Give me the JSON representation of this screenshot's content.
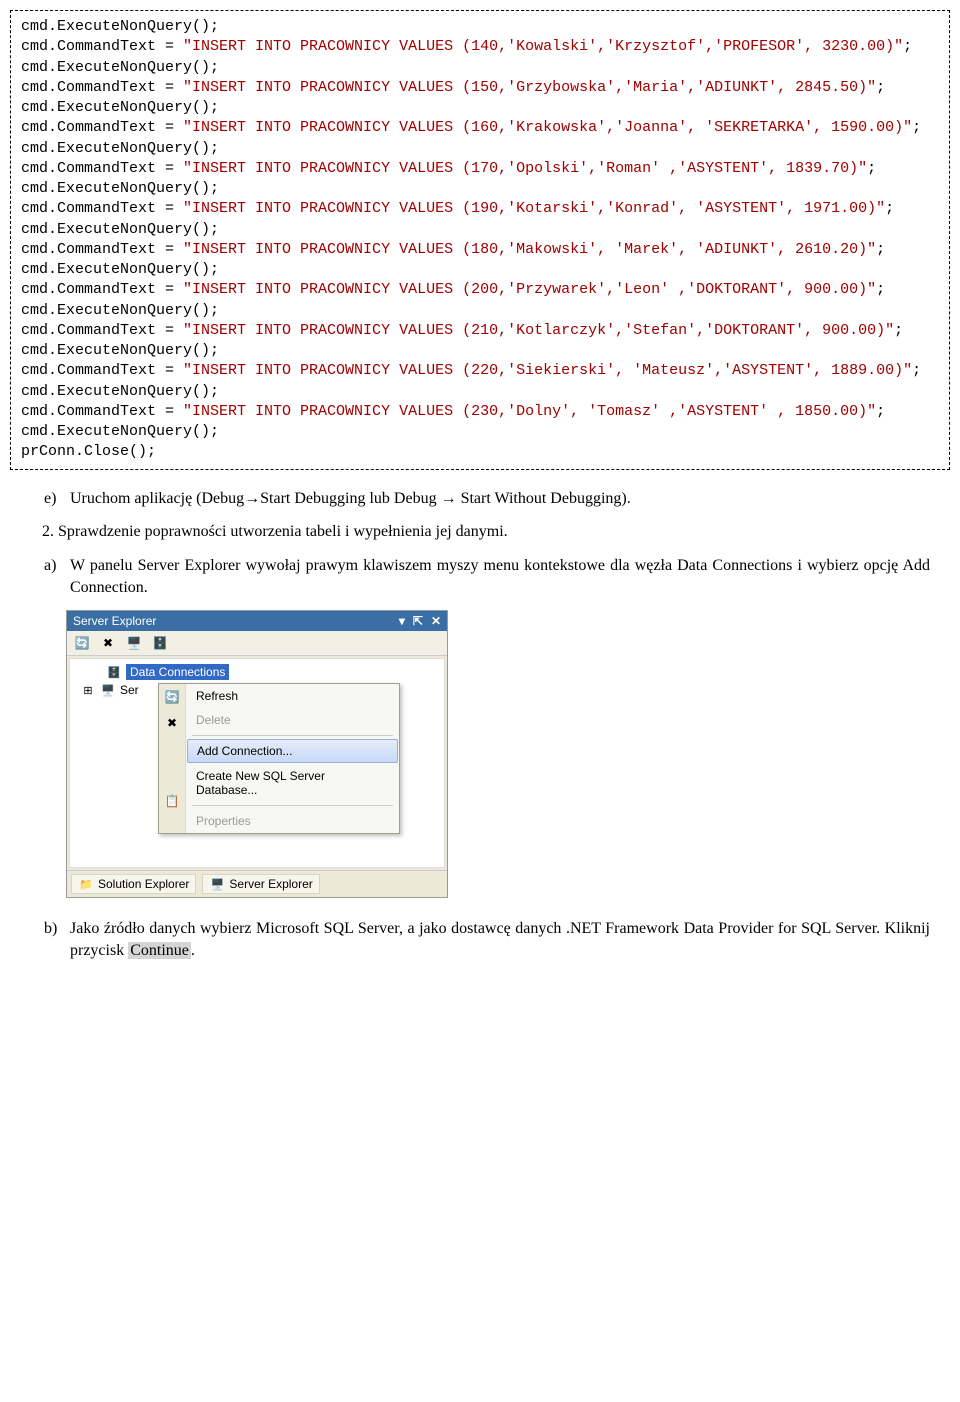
{
  "code": {
    "lines": [
      {
        "t": "cmd.ExecuteNonQuery();",
        "c": "black"
      },
      {
        "t": "cmd.CommandText = ",
        "c": "black",
        "cont": [
          {
            "t": "\"INSERT INTO PRACOWNICY VALUES (140,'Kowalski','Krzysztof','PROFESOR', 3230.00)\"",
            "c": "red"
          },
          {
            "t": ";",
            "c": "black"
          }
        ]
      },
      {
        "t": "cmd.ExecuteNonQuery();",
        "c": "black"
      },
      {
        "t": "cmd.CommandText = ",
        "c": "black",
        "cont": [
          {
            "t": "\"INSERT INTO PRACOWNICY VALUES (150,'Grzybowska','Maria','ADIUNKT', 2845.50)\"",
            "c": "red"
          },
          {
            "t": ";",
            "c": "black"
          }
        ]
      },
      {
        "t": "cmd.ExecuteNonQuery();",
        "c": "black"
      },
      {
        "t": "cmd.CommandText = ",
        "c": "black",
        "cont": [
          {
            "t": "\"INSERT INTO PRACOWNICY VALUES (160,'Krakowska','Joanna', 'SEKRETARKA', 1590.00)\"",
            "c": "red"
          },
          {
            "t": ";",
            "c": "black"
          }
        ]
      },
      {
        "t": "cmd.ExecuteNonQuery();",
        "c": "black"
      },
      {
        "t": "cmd.CommandText = ",
        "c": "black",
        "cont": [
          {
            "t": "\"INSERT INTO PRACOWNICY VALUES (170,'Opolski','Roman' ,'ASYSTENT', 1839.70)\"",
            "c": "red"
          },
          {
            "t": ";",
            "c": "black"
          }
        ]
      },
      {
        "t": "cmd.ExecuteNonQuery();",
        "c": "black"
      },
      {
        "t": "cmd.CommandText = ",
        "c": "black",
        "cont": [
          {
            "t": "\"INSERT INTO PRACOWNICY VALUES (190,'Kotarski','Konrad', 'ASYSTENT', 1971.00)\"",
            "c": "red"
          },
          {
            "t": ";",
            "c": "black"
          }
        ]
      },
      {
        "t": "cmd.ExecuteNonQuery();",
        "c": "black"
      },
      {
        "t": "cmd.CommandText = ",
        "c": "black",
        "cont": [
          {
            "t": "\"INSERT INTO PRACOWNICY VALUES (180,'Makowski', 'Marek', 'ADIUNKT', 2610.20)\"",
            "c": "red"
          },
          {
            "t": ";",
            "c": "black"
          }
        ]
      },
      {
        "t": "cmd.ExecuteNonQuery();",
        "c": "black"
      },
      {
        "t": "cmd.CommandText = ",
        "c": "black",
        "cont": [
          {
            "t": "\"INSERT INTO PRACOWNICY VALUES (200,'Przywarek','Leon' ,'DOKTORANT', 900.00)\"",
            "c": "red"
          },
          {
            "t": ";",
            "c": "black"
          }
        ]
      },
      {
        "t": "cmd.ExecuteNonQuery();",
        "c": "black"
      },
      {
        "t": "cmd.CommandText = ",
        "c": "black",
        "cont": [
          {
            "t": "\"INSERT INTO PRACOWNICY VALUES (210,'Kotlarczyk','Stefan','DOKTORANT', 900.00)\"",
            "c": "red"
          },
          {
            "t": ";",
            "c": "black"
          }
        ]
      },
      {
        "t": "cmd.ExecuteNonQuery();",
        "c": "black"
      },
      {
        "t": "cmd.CommandText = ",
        "c": "black",
        "cont": [
          {
            "t": "\"INSERT INTO PRACOWNICY VALUES (220,'Siekierski', 'Mateusz','ASYSTENT', 1889.00)\"",
            "c": "red"
          },
          {
            "t": ";",
            "c": "black"
          }
        ]
      },
      {
        "t": "cmd.ExecuteNonQuery();",
        "c": "black"
      },
      {
        "t": "cmd.CommandText = ",
        "c": "black",
        "cont": [
          {
            "t": "\"INSERT INTO PRACOWNICY VALUES (230,'Dolny', 'Tomasz' ,'ASYSTENT' , 1850.00)\"",
            "c": "red"
          },
          {
            "t": ";",
            "c": "black"
          }
        ]
      },
      {
        "t": "cmd.ExecuteNonQuery();",
        "c": "black"
      },
      {
        "t": "prConn.Close();",
        "c": "black"
      }
    ]
  },
  "text": {
    "e_label": "e)",
    "e_body": "Uruchom aplikację (Debug→Start Debugging lub Debug → Start Without Debugging).",
    "step2": "2. Sprawdzenie poprawności utworzenia tabeli i wypełnienia jej danymi.",
    "a_label": "a)",
    "a_body": "W panelu Server Explorer wywołaj prawym klawiszem myszy menu kontekstowe dla węzła Data Connections i wybierz opcję Add Connection.",
    "b_label": "b)",
    "b_body_pre": "Jako źródło danych wybierz Microsoft SQL Server, a jako dostawcę danych .NET Framework Data Provider for SQL Server. Kliknij przycisk ",
    "b_continue": "Continue",
    "b_body_post": "."
  },
  "se": {
    "title": "Server Explorer",
    "ctl_down": "▾",
    "ctl_pin": "⇱",
    "ctl_close": "✕",
    "tree": {
      "data_connections": "Data Connections",
      "serv_prefix": "Ser"
    },
    "ctx": {
      "refresh": "Refresh",
      "delete": "Delete",
      "add_connection": "Add Connection...",
      "create_db": "Create New SQL Server Database...",
      "properties": "Properties"
    },
    "tabs": {
      "solution": "Solution Explorer",
      "server": "Server Explorer"
    }
  }
}
